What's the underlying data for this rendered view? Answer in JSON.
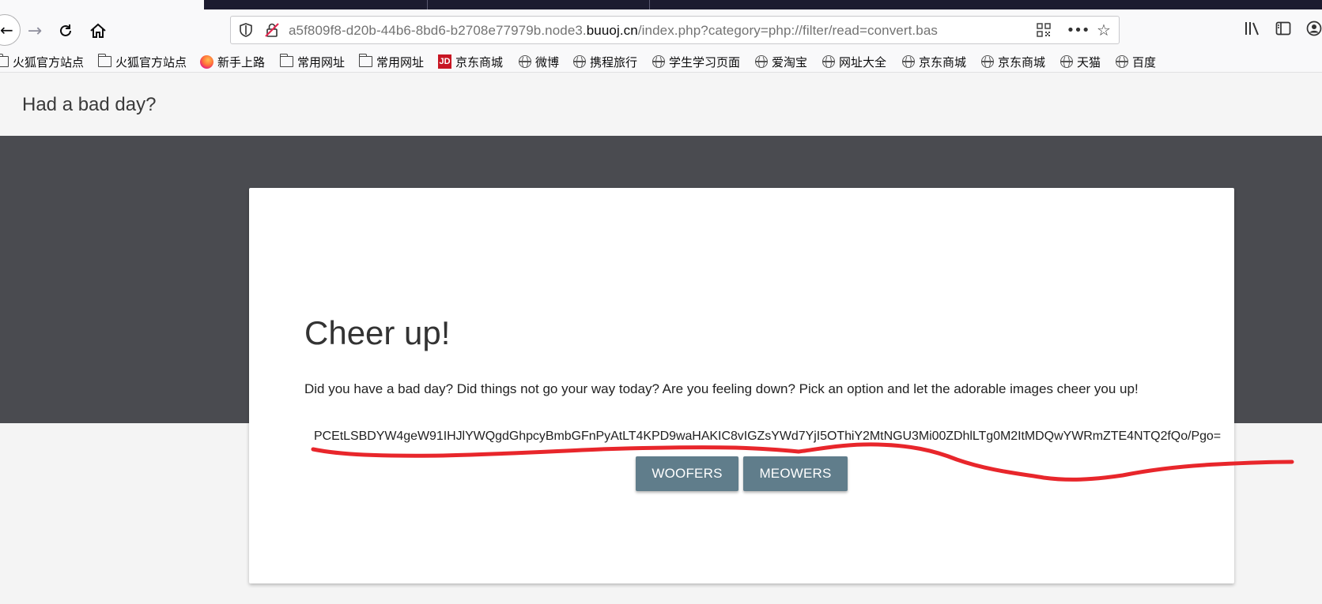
{
  "browser": {
    "url_prefix": "a5f809f8-d20b-44b6-8bd6-b2708e77979b.node3.",
    "url_host": "buuoj.cn",
    "url_path": "/index.php?category=php://filter/read=convert.bas",
    "icons": [
      "back-icon",
      "forward-icon",
      "reload-icon",
      "home-icon",
      "shield-icon",
      "insecure-lock-icon",
      "qr-code-icon",
      "more-actions-icon",
      "bookmark-star-icon",
      "library-icon",
      "sidebar-icon",
      "account-icon"
    ]
  },
  "bookmarks": [
    {
      "label": "火狐官方站点",
      "icon": "folder-icon"
    },
    {
      "label": "火狐官方站点",
      "icon": "folder-icon"
    },
    {
      "label": "新手上路",
      "icon": "firefox-icon"
    },
    {
      "label": "常用网址",
      "icon": "folder-icon"
    },
    {
      "label": "常用网址",
      "icon": "folder-icon"
    },
    {
      "label": "京东商城",
      "icon": "jd-icon"
    },
    {
      "label": "微博",
      "icon": "globe-icon"
    },
    {
      "label": "携程旅行",
      "icon": "globe-icon"
    },
    {
      "label": "学生学习页面",
      "icon": "globe-icon"
    },
    {
      "label": "爱淘宝",
      "icon": "globe-icon"
    },
    {
      "label": "网址大全",
      "icon": "globe-icon"
    },
    {
      "label": "京东商城",
      "icon": "globe-icon"
    },
    {
      "label": "京东商城",
      "icon": "globe-icon"
    },
    {
      "label": "天猫",
      "icon": "globe-icon"
    },
    {
      "label": "百度",
      "icon": "globe-icon"
    }
  ],
  "jd_badge": "JD",
  "page": {
    "site_title": "Had a bad day?",
    "heading": "Cheer up!",
    "description": "Did you have a bad day? Did things not go your way today? Are you feeling down? Pick an option and let the adorable images cheer you up!",
    "encoded_output": "PCEtLSBDYW4geW91IHJlYWQgdGhpcyBmbGFnPyAtLT4KPD9waHAKIC8vIGZsYWd7YjI5OThiY2MtNGU3Mi00ZDhlLTg0M2ItMDQwYWRmZTE4NTQ2fQo/Pgo=",
    "woofers_label": "WOOFERS",
    "meowers_label": "MEOWERS"
  },
  "colors": {
    "hero_bg": "#4a4b50",
    "button_bg": "#607d8b",
    "annotation_red": "#e8262b"
  }
}
